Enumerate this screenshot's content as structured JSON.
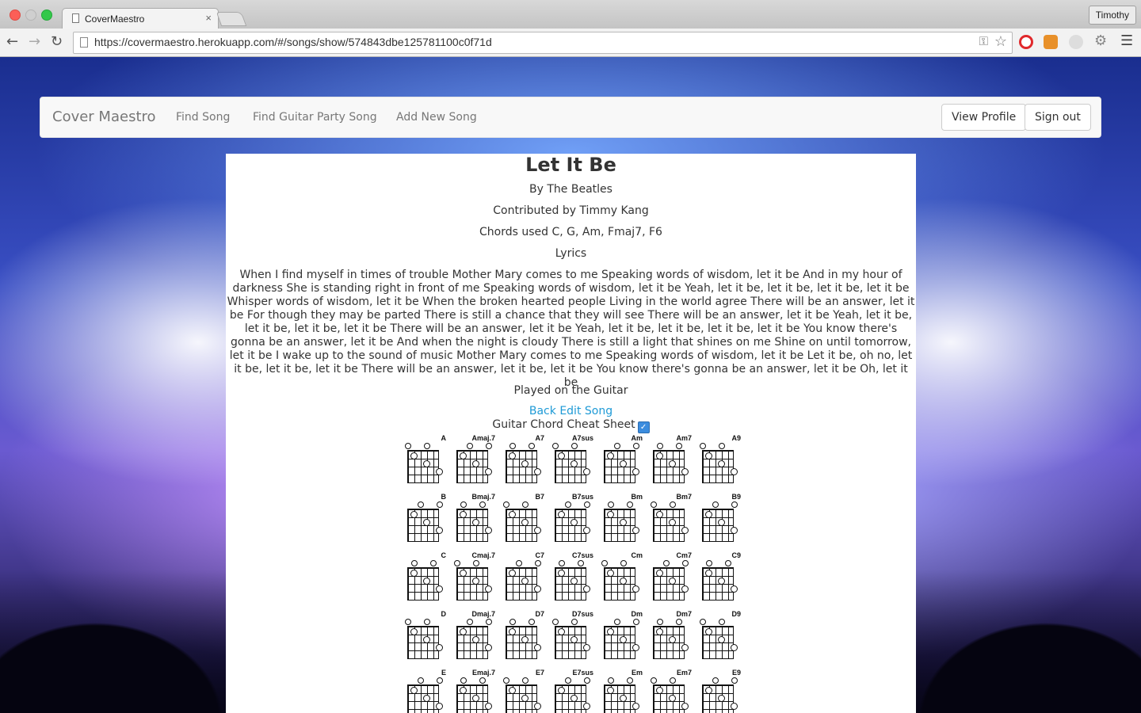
{
  "browser": {
    "tab_title": "CoverMaestro",
    "tab_close": "×",
    "user": "Timothy",
    "url": "https://covermaestro.herokuapp.com/#/songs/show/574843dbe125781100c0f71d"
  },
  "navbar": {
    "brand": "Cover Maestro",
    "links": [
      "Find Song",
      "Find Guitar Party Song",
      "Add New Song"
    ],
    "view_profile": "View Profile",
    "sign_out": "Sign out"
  },
  "song": {
    "title": "Let It Be",
    "artist": "By The Beatles",
    "contributor": "Contributed by Timmy Kang",
    "chords": "Chords used C, G, Am, Fmaj7, F6",
    "lyrics_heading": "Lyrics",
    "lyrics": "When I find myself in times of trouble Mother Mary comes to me Speaking words of wisdom, let it be And in my hour of darkness She is standing right in front of me Speaking words of wisdom, let it be Yeah, let it be, let it be, let it be, let it be Whisper words of wisdom, let it be When the broken hearted people Living in the world agree There will be an answer, let it be For though they may be parted There is still a chance that they will see There will be an answer, let it be Yeah, let it be, let it be, let it be, let it be There will be an answer, let it be Yeah, let it be, let it be, let it be, let it be You know there's gonna be an answer, let it be And when the night is cloudy There is still a light that shines on me Shine on until tomorrow, let it be I wake up to the sound of music Mother Mary comes to me Speaking words of wisdom, let it be Let it be, oh no, let it be, let it be, let it be There will be an answer, let it be, let it be You know there's gonna be an answer, let it be Oh, let it be",
    "played_on": "Played on the Guitar",
    "back_link": "Back",
    "edit_link": "Edit Song",
    "cheat_sheet_label": "Guitar Chord Cheat Sheet",
    "cheat_sheet_checked": true
  },
  "chord_chart": {
    "names": [
      "A",
      "Amaj.7",
      "A7",
      "A7sus",
      "Am",
      "Am7",
      "A9",
      "B",
      "Bmaj.7",
      "B7",
      "B7sus",
      "Bm",
      "Bm7",
      "B9",
      "C",
      "Cmaj.7",
      "C7",
      "C7sus",
      "Cm",
      "Cm7",
      "C9",
      "D",
      "Dmaj.7",
      "D7",
      "D7sus",
      "Dm",
      "Dm7",
      "D9",
      "E",
      "Emaj.7",
      "E7",
      "E7sus",
      "Em",
      "Em7",
      "E9"
    ]
  },
  "icons": {
    "back": "back-arrow-icon",
    "forward": "forward-arrow-icon",
    "reload": "reload-icon",
    "star": "star-icon",
    "menu": "menu-icon"
  }
}
